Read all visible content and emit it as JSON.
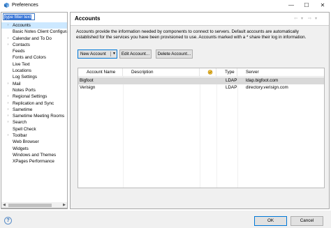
{
  "window": {
    "title": "Preferences",
    "minimize": "—",
    "maximize": "☐",
    "close": "✕"
  },
  "left": {
    "filter_placeholder": "type filter text",
    "tree": [
      {
        "label": "Accounts",
        "arrow": "›",
        "selected": true
      },
      {
        "label": "Basic Notes Client Configura",
        "arrow": ""
      },
      {
        "label": "Calendar and To Do",
        "arrow": "›"
      },
      {
        "label": "Contacts",
        "arrow": "›"
      },
      {
        "label": "Feeds",
        "arrow": ""
      },
      {
        "label": "Fonts and Colors",
        "arrow": ""
      },
      {
        "label": "Live Text",
        "arrow": ""
      },
      {
        "label": "Locations",
        "arrow": ""
      },
      {
        "label": "Log Settings",
        "arrow": ""
      },
      {
        "label": "Mail",
        "arrow": "›"
      },
      {
        "label": "Notes Ports",
        "arrow": ""
      },
      {
        "label": "Regional Settings",
        "arrow": "›"
      },
      {
        "label": "Replication and Sync",
        "arrow": "›"
      },
      {
        "label": "Sametime",
        "arrow": "›"
      },
      {
        "label": "Sametime Meeting Rooms",
        "arrow": "›"
      },
      {
        "label": "Search",
        "arrow": "›"
      },
      {
        "label": "Spell Check",
        "arrow": ""
      },
      {
        "label": "Toolbar",
        "arrow": "›"
      },
      {
        "label": "Web Browser",
        "arrow": ""
      },
      {
        "label": "Widgets",
        "arrow": ""
      },
      {
        "label": "Windows and Themes",
        "arrow": ""
      },
      {
        "label": "XPages Performance",
        "arrow": ""
      }
    ]
  },
  "right": {
    "title": "Accounts",
    "description_lines": [
      "Accounts provide the information needed by components to connect to servers.  Default accounts are automatically",
      "established for the services you have been provisioned to use.  Accounts marked with a * share their log in information."
    ],
    "buttons": {
      "new": "New Account",
      "edit": "Edit Account...",
      "delete": "Delete Account..."
    },
    "table": {
      "columns": [
        "Account Name",
        "Description",
        "",
        "Type",
        "Server"
      ],
      "rows": [
        {
          "name": "Bigfoot",
          "description": "",
          "type": "LDAP",
          "server": "ldap.bigfoot.com",
          "selected": true
        },
        {
          "name": "Verisign",
          "description": "",
          "type": "LDAP",
          "server": "directory.verisign.com",
          "selected": false
        }
      ]
    }
  },
  "footer": {
    "ok": "OK",
    "cancel": "Cancel"
  },
  "colors": {
    "selection": "#cce8ff",
    "filter_highlight": "#3875d7",
    "row_selected": "#d9d9d9",
    "default_button_border": "#0078d7"
  }
}
